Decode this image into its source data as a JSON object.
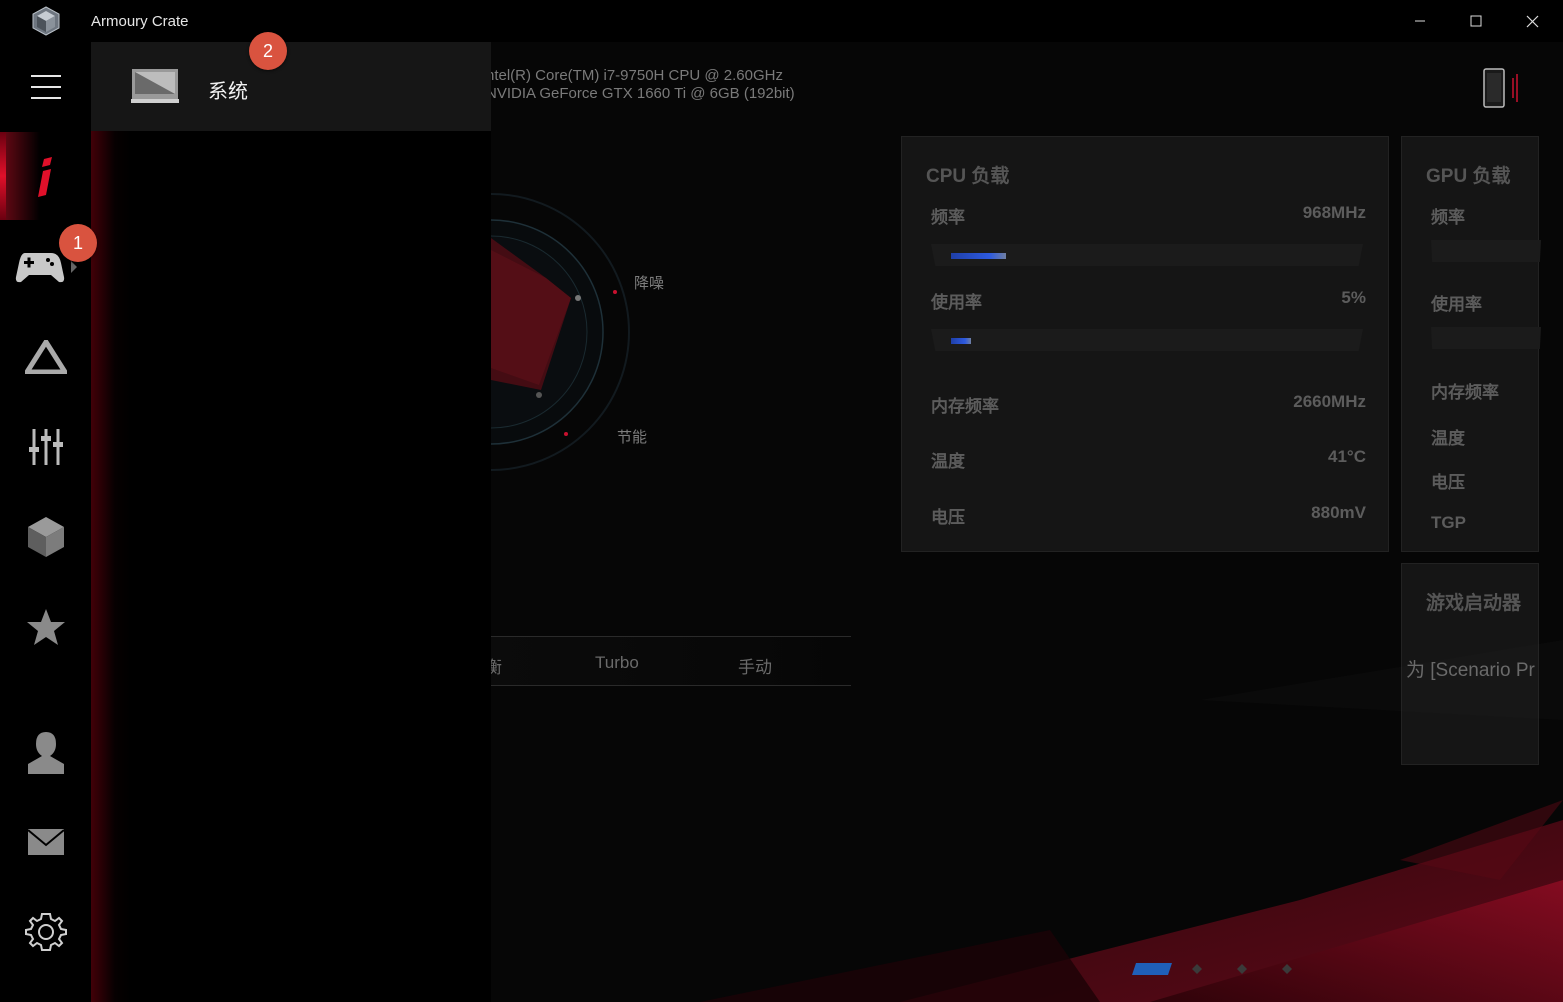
{
  "window": {
    "title": "Armoury Crate"
  },
  "flyout": {
    "items": [
      {
        "label": "系统"
      }
    ]
  },
  "badges": {
    "first": "1",
    "second": "2"
  },
  "system_info": {
    "cpu": "ntel(R) Core(TM) i7-9750H CPU @ 2.60GHz",
    "gpu": "NVIDIA GeForce GTX 1660 Ti @ 6GB (192bit)"
  },
  "gauge": {
    "label_quiet": "降噪",
    "label_eco": "节能"
  },
  "modes": {
    "partial_left": "衡",
    "turbo": "Turbo",
    "manual": "手动"
  },
  "cpu_panel": {
    "title": "CPU 负载",
    "freq_label": "频率",
    "freq_value": "968MHz",
    "freq_level": 0.14,
    "usage_label": "使用率",
    "usage_value": "5%",
    "usage_level": 0.05,
    "mem_freq_label": "内存频率",
    "mem_freq_value": "2660MHz",
    "temp_label": "温度",
    "temp_value": "41°C",
    "voltage_label": "电压",
    "voltage_value": "880mV"
  },
  "gpu_panel": {
    "title": "GPU 负载",
    "freq_label": "频率",
    "usage_label": "使用率",
    "mem_freq_label": "内存频率",
    "temp_label": "温度",
    "voltage_label": "电压",
    "tgp_label": "TGP"
  },
  "launcher_panel": {
    "title": "游戏启动器",
    "text": "为 [Scenario Pr"
  },
  "pagination": {
    "count": 4,
    "active_index": 0
  },
  "colors": {
    "accent_red": "#e0102a",
    "badge": "#d9533f",
    "bar_blue": "#2d5ae0"
  },
  "icons": {
    "rail": [
      "hamburger-menu-icon",
      "rog-i-icon",
      "gamepad-icon",
      "aura-triangle-icon",
      "equalizer-sliders-icon",
      "cube-icon",
      "star-icon",
      "user-icon",
      "mail-icon",
      "settings-gear-icon"
    ],
    "flyout_item": "laptop-icon",
    "device": "phone-device-icon"
  }
}
